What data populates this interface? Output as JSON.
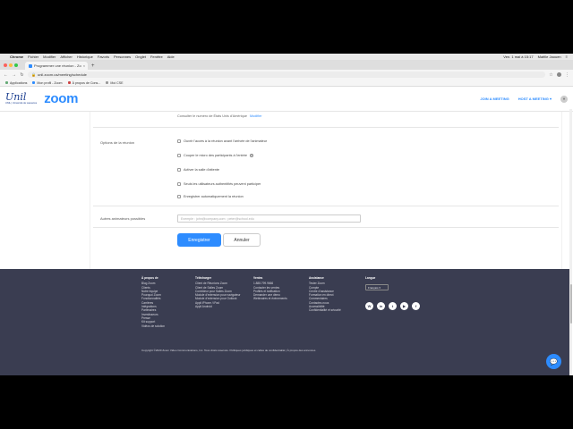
{
  "menubar": {
    "app": "Chrome",
    "items": [
      "Fichier",
      "Modifier",
      "Afficher",
      "Historique",
      "Favoris",
      "Personnes",
      "Onglet",
      "Fenêtre",
      "Aide"
    ],
    "clock": "Ven. 1 mai à 15:17",
    "user": "Maëlle Jaouen",
    "extra": "≡"
  },
  "tab": {
    "title": "Programmer une réunion - Zo"
  },
  "address": {
    "url": "unil.zoom.us/meeting/schedule"
  },
  "bookmarks": [
    "Applications",
    "Mon profil - Zoom",
    "À propos de Cons...",
    "Moi CSE"
  ],
  "header": {
    "logo_script": "Unil",
    "logo_sub": "UNIL | Université de Lausanne",
    "logo": "zoom",
    "join": "JOIN A MEETING",
    "host": "HOST A MEETING ▾"
  },
  "form": {
    "tz_text": "Consulter le numéro de États Unis d'Amérique",
    "tz_link": "Modifier",
    "options_label": "Options de la réunion",
    "options": [
      "Ouvrir l'accès à la réunion avant l'arrivée de l'animateur",
      "Couper le micro des participants à l'entrée",
      "Activer la salle d'attente",
      "Seuls les utilisateurs authentifiés peuvent participer",
      "Enregistrer automatiquement la réunion"
    ],
    "hosts_label": "Autres animateurs possibles",
    "hosts_placeholder": "Exemple : john@company.com ; peter@school.edu",
    "save": "Enregistrer",
    "cancel": "Annuler"
  },
  "footer": {
    "col1": {
      "h": "À propos de",
      "items": [
        "Blog Zoom",
        "Clients",
        "Notre équipe",
        "Pourquoi Zoom",
        "Fonctionnalités",
        "Carrières",
        "Intégrations",
        "Partenaires",
        "Investisseurs",
        "Presse",
        "Kit support",
        "Vidéos de solution"
      ]
    },
    "col2": {
      "h": "Télécharger",
      "items": [
        "Client de Réunions Zoom",
        "Client de Salles Zoom",
        "Contrôleur pour Salles Zoom",
        "Module d'extension pour navigateur",
        "Module d'extension pour Outlook",
        "Appli iPhone / iPad",
        "Appli Android"
      ]
    },
    "col3": {
      "h": "Ventes",
      "items": [
        "1.888.799.9666",
        "Contacter les ventes",
        "Profilés et tarification",
        "Demander une démo",
        "Webinaires et événements"
      ]
    },
    "col4": {
      "h": "Assistance",
      "items": [
        "Tester Zoom",
        "Compte",
        "Centre d'assistance",
        "Formation en direct",
        "Commentaires",
        "Contactez-nous",
        "Accessibilité",
        "Confidentialité et sécurité"
      ]
    },
    "col5": {
      "h": "Langue",
      "select": "Français ▾"
    },
    "copyright": "Copyright ©2020 Zoom Video Communications, Inc. Tous droits réservés.   Politiques juridiques et celles de confidentialité  |  À propos des annonces",
    "social": [
      "W",
      "in",
      "t",
      "▶",
      "f"
    ]
  }
}
